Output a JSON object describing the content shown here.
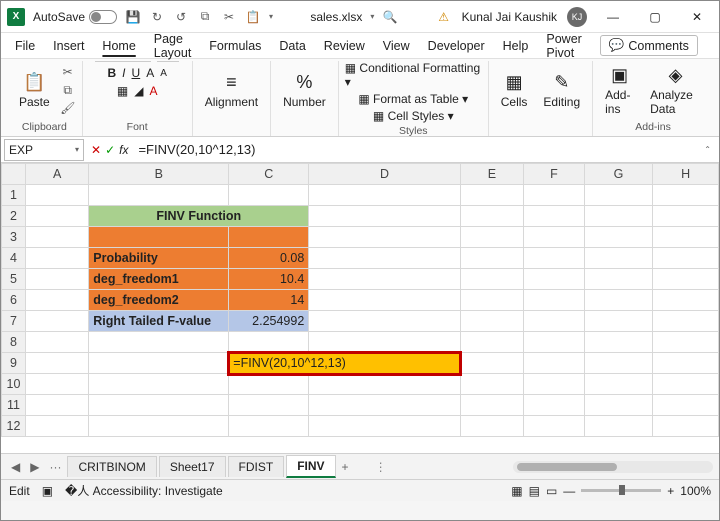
{
  "title": {
    "autosave": "AutoSave",
    "filename": "sales.xlsx",
    "user": "Kunal Jai Kaushik",
    "initials": "KJ"
  },
  "menu": {
    "file": "File",
    "insert": "Insert",
    "home": "Home",
    "page": "Page Layout",
    "formulas": "Formulas",
    "data": "Data",
    "review": "Review",
    "view": "View",
    "developer": "Developer",
    "help": "Help",
    "power": "Power Pivot",
    "comments": "Comments"
  },
  "ribbon": {
    "paste": "Paste",
    "clipboard": "Clipboard",
    "font": "Font",
    "alignment": "Alignment",
    "number": "Number",
    "cond": "Conditional Formatting",
    "table": "Format as Table",
    "cellstyles": "Cell Styles",
    "styles": "Styles",
    "cells": "Cells",
    "editing": "Editing",
    "addins": "Add-ins",
    "analyze": "Analyze Data",
    "fontname": "",
    "size": "",
    "b": "B",
    "i": "I",
    "u": "U"
  },
  "fbar": {
    "name": "EXP",
    "formula": "=FINV(20,10^12,13)"
  },
  "cols": {
    "A": "A",
    "B": "B",
    "C": "C",
    "D": "D",
    "E": "E",
    "F": "F",
    "G": "G",
    "H": "H"
  },
  "rows": {
    "r1": "1",
    "r2": "2",
    "r3": "3",
    "r4": "4",
    "r5": "5",
    "r6": "6",
    "r7": "7",
    "r8": "8",
    "r9": "9",
    "r10": "10",
    "r11": "11",
    "r12": "12"
  },
  "sheet": {
    "hdr": "FINV Function",
    "prob": "Probability",
    "prob_v": "0.08",
    "df1": "deg_freedom1",
    "df1_v": "10.4",
    "df2": "deg_freedom2",
    "df2_v": "14",
    "rt": "Right Tailed F-value",
    "rt_v": "2.254992",
    "edit": "=FINV(20,10^12,13)"
  },
  "tabs": {
    "t1": "CRITBINOM",
    "t2": "Sheet17",
    "t3": "FDIST",
    "t4": "FINV",
    "dots": "···",
    "plus": "+"
  },
  "status": {
    "mode": "Edit",
    "acc": "Accessibility: Investigate",
    "zoom": "100%"
  },
  "chart_data": {
    "type": "table",
    "title": "FINV Function",
    "rows": [
      {
        "label": "Probability",
        "value": 0.08
      },
      {
        "label": "deg_freedom1",
        "value": 10.4
      },
      {
        "label": "deg_freedom2",
        "value": 14
      },
      {
        "label": "Right Tailed F-value",
        "value": 2.254992
      }
    ],
    "formula": "=FINV(20,10^12,13)"
  }
}
